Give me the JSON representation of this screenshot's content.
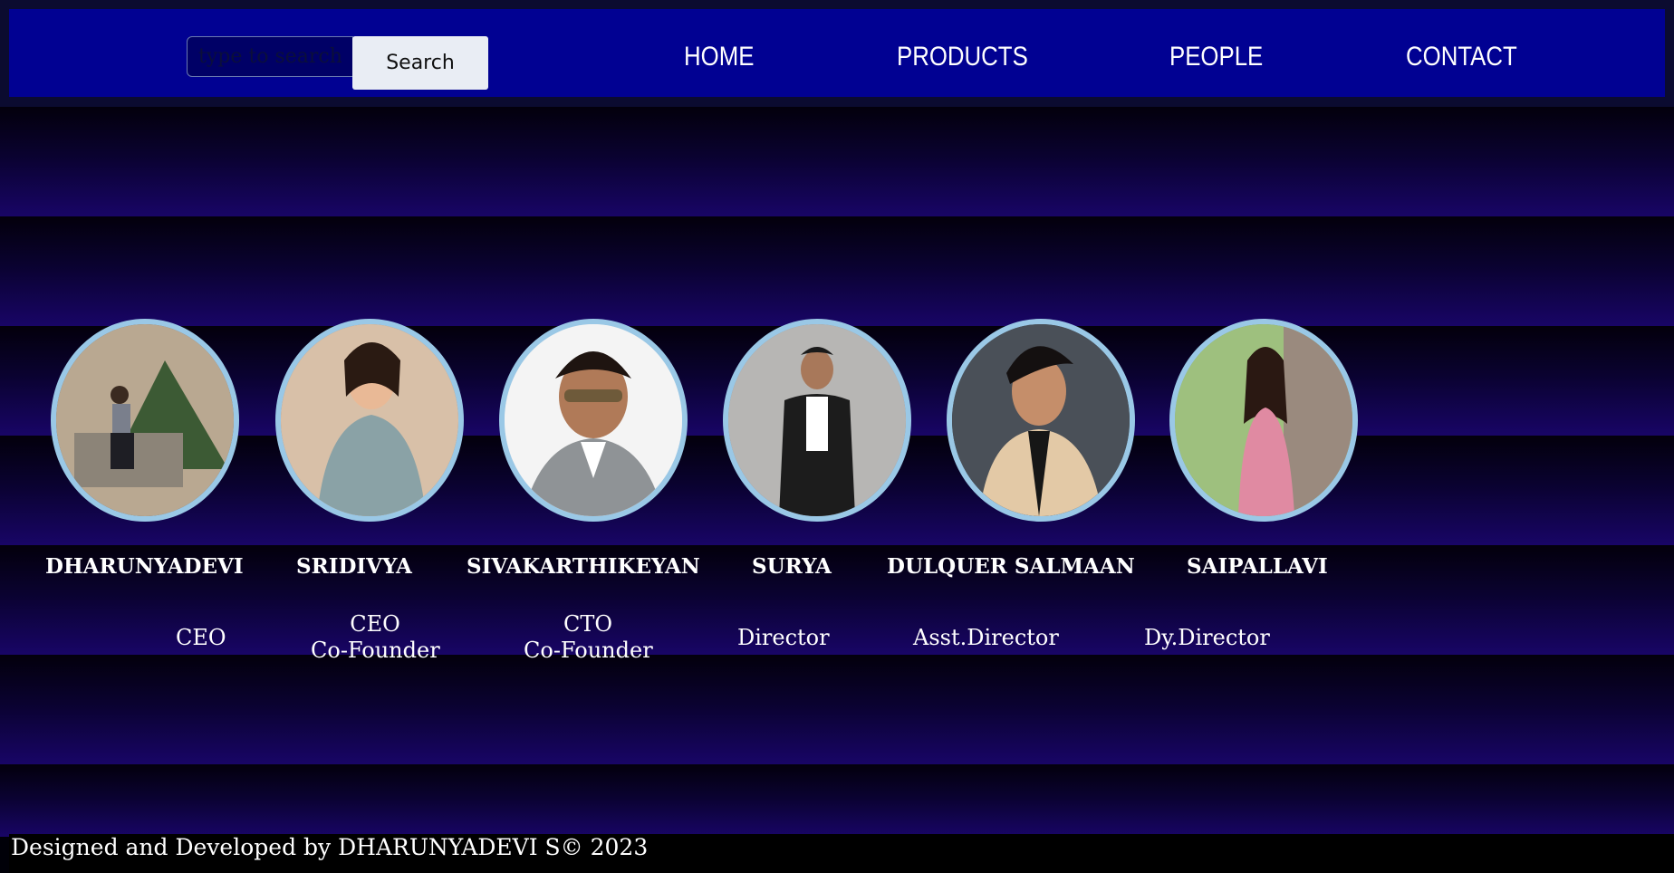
{
  "search": {
    "placeholder": "type to search",
    "button_label": "Search"
  },
  "nav": {
    "items": [
      {
        "label": "HOME"
      },
      {
        "label": "PRODUCTS"
      },
      {
        "label": "PEOPLE"
      },
      {
        "label": "CONTACT"
      }
    ]
  },
  "people": [
    {
      "name": "DHARUNYADEVI",
      "role_line1": "CEO",
      "role_line2": "",
      "photo_icon": "portrait-photo-icon"
    },
    {
      "name": "SRIDIVYA",
      "role_line1": "CEO",
      "role_line2": "Co-Founder",
      "photo_icon": "portrait-photo-icon"
    },
    {
      "name": "SIVAKARTHIKEYAN",
      "role_line1": "CTO",
      "role_line2": "Co-Founder",
      "photo_icon": "portrait-photo-icon"
    },
    {
      "name": "SURYA",
      "role_line1": "Director",
      "role_line2": "",
      "photo_icon": "portrait-photo-icon"
    },
    {
      "name": "DULQUER SALMAAN",
      "role_line1": "Asst.Director",
      "role_line2": "",
      "photo_icon": "portrait-photo-icon"
    },
    {
      "name": "SAIPALLAVI",
      "role_line1": "Dy.Director",
      "role_line2": "",
      "photo_icon": "portrait-photo-icon"
    }
  ],
  "footer": {
    "text": "Designed and Developed by DHARUNYADEVI S© 2023"
  },
  "colors": {
    "navbar": "#010192",
    "band_top": "#03000c",
    "band_bottom": "#180566",
    "avatar_border": "#9ac8e6"
  }
}
